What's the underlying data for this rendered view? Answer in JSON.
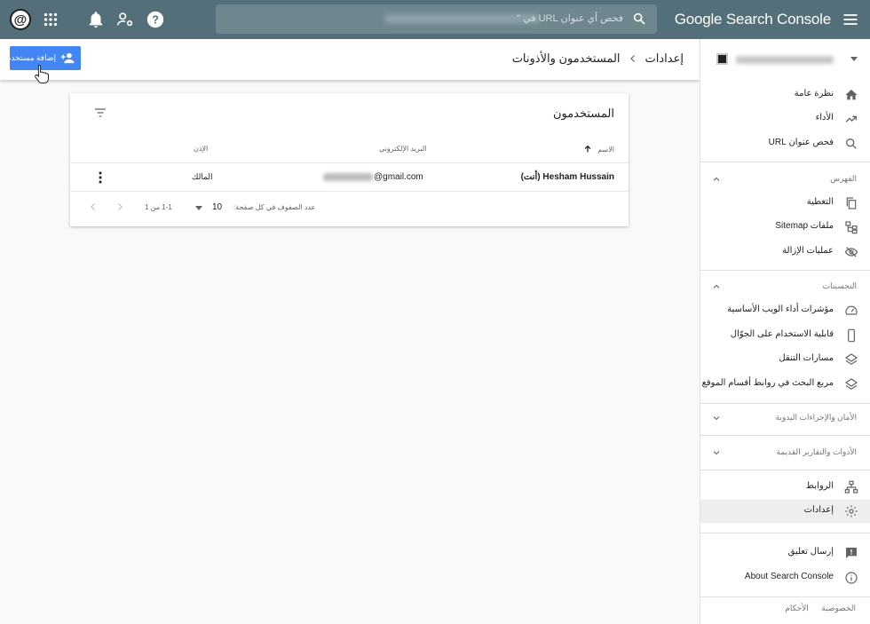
{
  "topbar": {
    "brand": "Google Search Console",
    "search_placeholder": "فحص أي عنوان URL في \""
  },
  "sidebar": {
    "nav_top": [
      {
        "label": "نظرة عامة",
        "icon": "home-icon"
      },
      {
        "label": "الأداء",
        "icon": "trending-up-icon"
      },
      {
        "label": "فحص عنوان URL",
        "icon": "search-icon"
      }
    ],
    "sections": {
      "index": "الفهرس",
      "enhancements": "التحسينات",
      "security": "الأمان والإجراءات اليدوية",
      "legacy": "الأدوات والتقارير القديمة"
    },
    "index_items": [
      {
        "label": "التغطية",
        "icon": "file-copy-icon"
      },
      {
        "label": "ملفات Sitemap",
        "icon": "sitemap-icon"
      },
      {
        "label": "عمليات الإزالة",
        "icon": "eye-off-icon"
      }
    ],
    "enh_items": [
      {
        "label": "مؤشرات أداء الويب الأساسية",
        "icon": "speed-gauge-icon"
      },
      {
        "label": "قابلية الاستخدام على الجوّال",
        "icon": "phone-icon"
      },
      {
        "label": "مسارات التنقل",
        "icon": "layers-icon"
      },
      {
        "label": "مربع البحث في روابط أقسام الموقع",
        "icon": "layers-icon"
      }
    ],
    "bottom_items": [
      {
        "label": "الروابط",
        "icon": "network-icon"
      },
      {
        "label": "إعدادات",
        "icon": "gear-icon"
      }
    ],
    "extra_items": [
      {
        "label": "إرسال تعليق",
        "icon": "feedback-icon"
      },
      {
        "label": "About Search Console",
        "icon": "info-icon"
      }
    ],
    "footer": {
      "privacy": "الخصوصية",
      "terms": "الأحكام"
    }
  },
  "header": {
    "crumb_root": "إعدادات",
    "crumb_current": "المستخدمون والأذونات",
    "add_user_label": "إضافة مستخدم"
  },
  "card": {
    "title": "المستخدمون",
    "columns": {
      "name": "الاسم",
      "email": "البريد الإلكتروني",
      "permission": "الإذن"
    },
    "rows": [
      {
        "name": "Hesham Hussain (أنت)",
        "email_domain": "@gmail.com",
        "permission": "المالك"
      }
    ],
    "pager": {
      "rows_per_page_label": "عدد الصفوف في كل صفحة:",
      "rows_per_page": "10",
      "range": "1-1 من 1"
    }
  },
  "colors": {
    "topbar": "#546e7a",
    "accent": "#4285f4"
  }
}
